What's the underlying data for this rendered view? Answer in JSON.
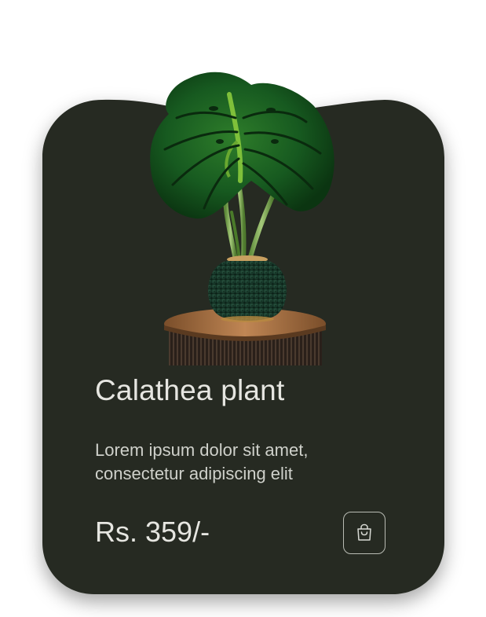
{
  "product": {
    "name": "Calathea plant",
    "description_lines": [
      "Lorem ipsum dolor sit amet,",
      "consectetur adipiscing elit"
    ],
    "price": "Rs. 359/-"
  },
  "icons": {
    "cart": "shopping-bag-icon"
  },
  "colors": {
    "card_background": "#262b22",
    "text_primary": "#e6e6e1",
    "text_secondary": "#cfd1cb",
    "button_border": "#b9bcb4"
  }
}
